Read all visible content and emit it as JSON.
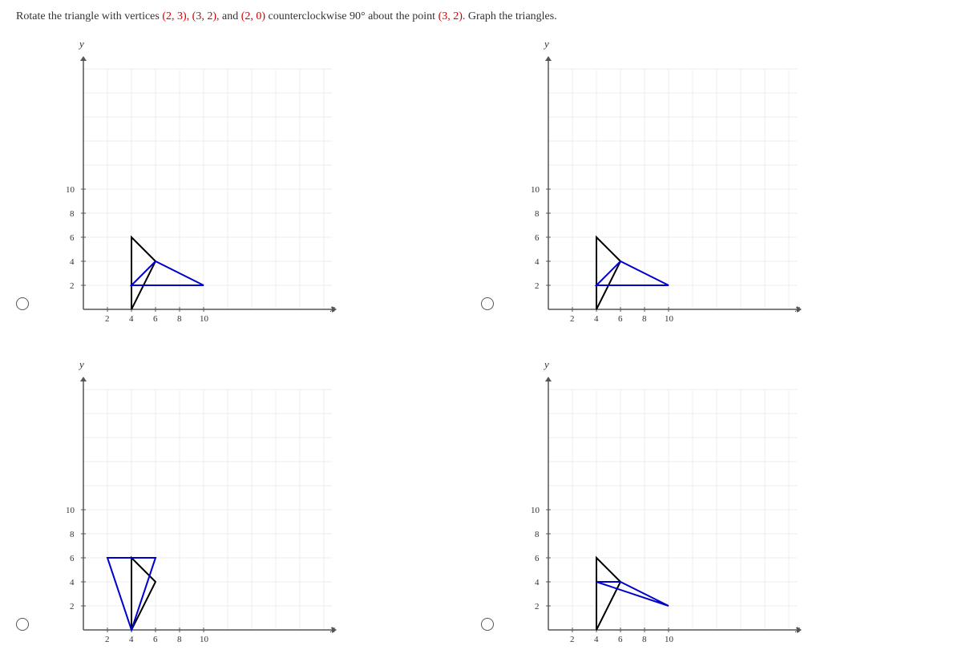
{
  "problem": {
    "text_before": "Rotate the triangle with vertices ",
    "v1": "(2, 3),",
    "sep1": " ",
    "v2": "(3, 2),",
    "and_text": " and ",
    "v3": "(2, 0)",
    "text_after": " counterclockwise 90° about the point ",
    "center": "(3, 2).",
    "text_end": " Graph the triangles."
  },
  "graphs": [
    {
      "id": "graph1",
      "correct": false
    },
    {
      "id": "graph2",
      "correct": false
    },
    {
      "id": "graph3",
      "correct": false
    },
    {
      "id": "graph4",
      "correct": false
    }
  ]
}
